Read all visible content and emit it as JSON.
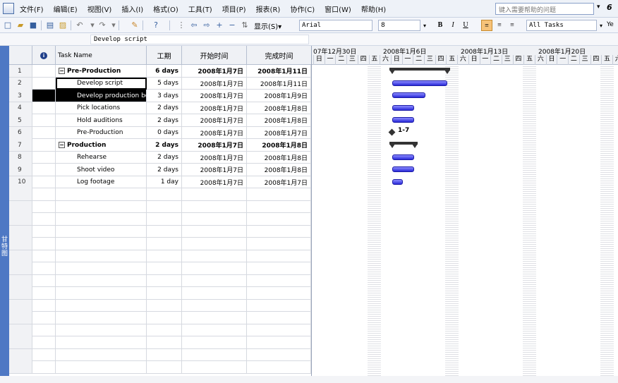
{
  "menu": {
    "items": [
      "文件(F)",
      "编辑(E)",
      "视图(V)",
      "插入(I)",
      "格式(O)",
      "工具(T)",
      "项目(P)",
      "报表(R)",
      "协作(C)",
      "窗口(W)",
      "帮助(H)"
    ],
    "help_placeholder": "键入需要帮助的问题",
    "extra": "6"
  },
  "toolbar": {
    "display_label": "显示(S)▾",
    "font": "Arial",
    "size": "8",
    "bold": "B",
    "italic": "I",
    "underline": "U",
    "filter": "All Tasks",
    "extra": "Ye"
  },
  "entry": {
    "value": "Develop script"
  },
  "viewbar": {
    "label": "甘特图"
  },
  "columns": {
    "indicator": "i",
    "name": "Task Name",
    "duration": "工期",
    "start": "开始时间",
    "finish": "完成时间"
  },
  "tasks": [
    {
      "id": "1",
      "name": "Pre-Production",
      "duration": "6 days",
      "start": "2008年1月7日",
      "finish": "2008年1月11日",
      "summary": true,
      "collapse": "−"
    },
    {
      "id": "2",
      "name": "Develop script",
      "duration": "5 days",
      "start": "2008年1月7日",
      "finish": "2008年1月11日",
      "summary": false
    },
    {
      "id": "3",
      "name": "Develop production bo",
      "duration": "3 days",
      "start": "2008年1月7日",
      "finish": "2008年1月9日",
      "summary": false
    },
    {
      "id": "4",
      "name": "Pick locations",
      "duration": "2 days",
      "start": "2008年1月7日",
      "finish": "2008年1月8日",
      "summary": false
    },
    {
      "id": "5",
      "name": "Hold auditions",
      "duration": "2 days",
      "start": "2008年1月7日",
      "finish": "2008年1月8日",
      "summary": false
    },
    {
      "id": "6",
      "name": "Pre-Production",
      "duration": "0 days",
      "start": "2008年1月7日",
      "finish": "2008年1月7日",
      "summary": false
    },
    {
      "id": "7",
      "name": "Production",
      "duration": "2 days",
      "start": "2008年1月7日",
      "finish": "2008年1月8日",
      "summary": true,
      "collapse": "−"
    },
    {
      "id": "8",
      "name": "Rehearse",
      "duration": "2 days",
      "start": "2008年1月7日",
      "finish": "2008年1月8日",
      "summary": false
    },
    {
      "id": "9",
      "name": "Shoot video",
      "duration": "2 days",
      "start": "2008年1月7日",
      "finish": "2008年1月8日",
      "summary": false
    },
    {
      "id": "10",
      "name": "Log footage",
      "duration": "1 day",
      "start": "2008年1月7日",
      "finish": "2008年1月7日",
      "summary": false
    }
  ],
  "gantt": {
    "weeks": [
      "07年12月30日",
      "2008年1月6日",
      "2008年1月13日",
      "2008年1月20日"
    ],
    "day_names": [
      "日",
      "一",
      "二",
      "三",
      "四",
      "五",
      "六"
    ],
    "milestone_label": "1-7"
  }
}
